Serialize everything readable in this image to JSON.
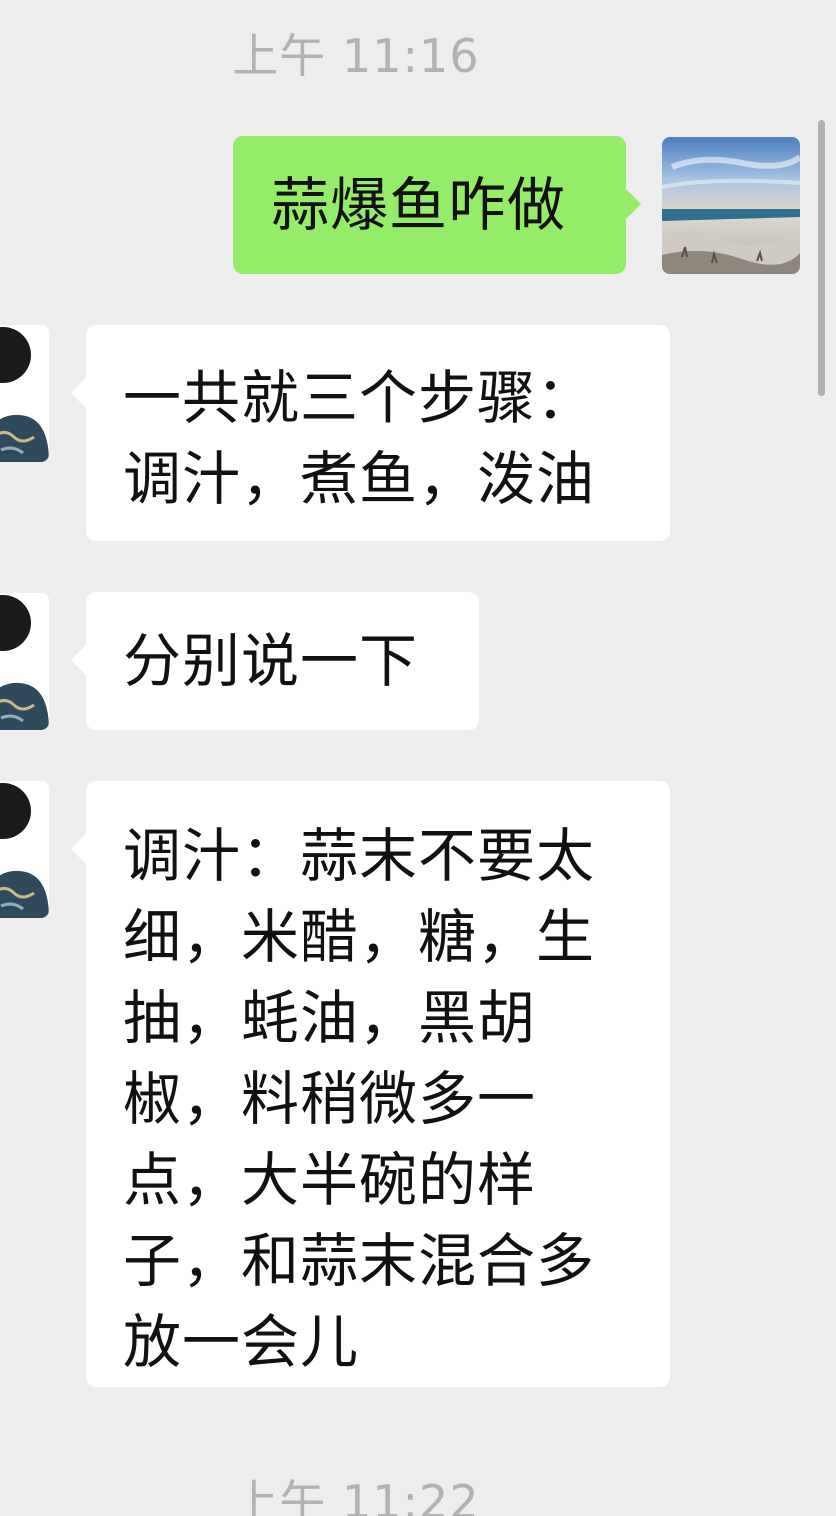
{
  "timestamps": {
    "first": "上午 11:16",
    "second": "上午 11:22"
  },
  "messages": [
    {
      "sender": "self",
      "text": "蒜爆鱼咋做"
    },
    {
      "sender": "other",
      "text": "一共就三个步骤：调汁，煮鱼，泼油"
    },
    {
      "sender": "other",
      "text": "分别说一下"
    },
    {
      "sender": "other",
      "text": "调汁：蒜末不要太细，米醋，糖，生抽，蚝油，黑胡椒，料稍微多一点，大半碗的样子，和蒜末混合多放一会儿"
    }
  ],
  "colors": {
    "background": "#ededed",
    "self_bubble": "#95ec69",
    "other_bubble": "#ffffff",
    "timestamp_text": "#b2b2b2"
  },
  "icons": {
    "self_avatar": "beach-landscape-avatar",
    "other_avatar": "portrait-painting-avatar"
  }
}
